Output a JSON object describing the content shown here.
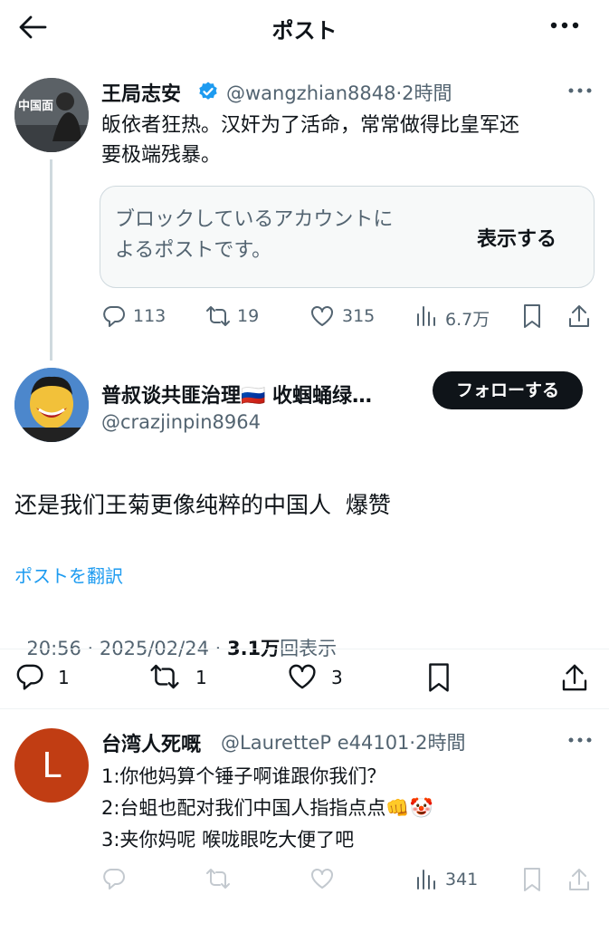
{
  "header": {
    "title": "ポスト",
    "back_icon": "arrow-left-icon",
    "more_icon": "more-horizontal-icon"
  },
  "parent_post": {
    "display_name": "王局志安",
    "verified": true,
    "handle_time": "@wangzhian8848·2時間",
    "text_line1": "皈依者狂热。汉奸为了活命，常常做得比皇军还",
    "text_line2": "要极端残暴。",
    "blocked_notice_line1": "ブロックしているアカウントに",
    "blocked_notice_line2": "よるポストです。",
    "show_button": "表示する",
    "replies": "113",
    "reposts": "19",
    "likes": "315",
    "views": "6.7万",
    "avatar_text": "中国面"
  },
  "main_post": {
    "display_name": "普叔谈共匪治理🇷🇺 收蝈蛹绿…",
    "handle": "@crazjinpin8964",
    "follow_button": "フォローする",
    "text": "还是我们王菊更像纯粹的中国人  爆赞",
    "translate_link": "ポストを翻訳",
    "timestamp": "20:56 · 2025/02/24 · ",
    "view_count": "3.1万",
    "view_label": "回表示",
    "replies": "1",
    "reposts": "1",
    "likes": "3"
  },
  "reply_post": {
    "display_name": "台湾人死嘅",
    "handle_time": "@LauretteP e44101·2時間",
    "line1": "1:你他妈算个锤子啊谁跟你我们？",
    "line2": "2:台蛆也配对我们中国人指指点点👊🤡",
    "line3": "3:夹你妈呢 喉咙眼吃大便了吧",
    "avatar_letter": "L",
    "views": "341"
  },
  "colors": {
    "link": "#1d9bf0",
    "verified": "#1d9bf0",
    "reply_avatar": "#c13d13",
    "follow_bg": "#0f1419"
  }
}
